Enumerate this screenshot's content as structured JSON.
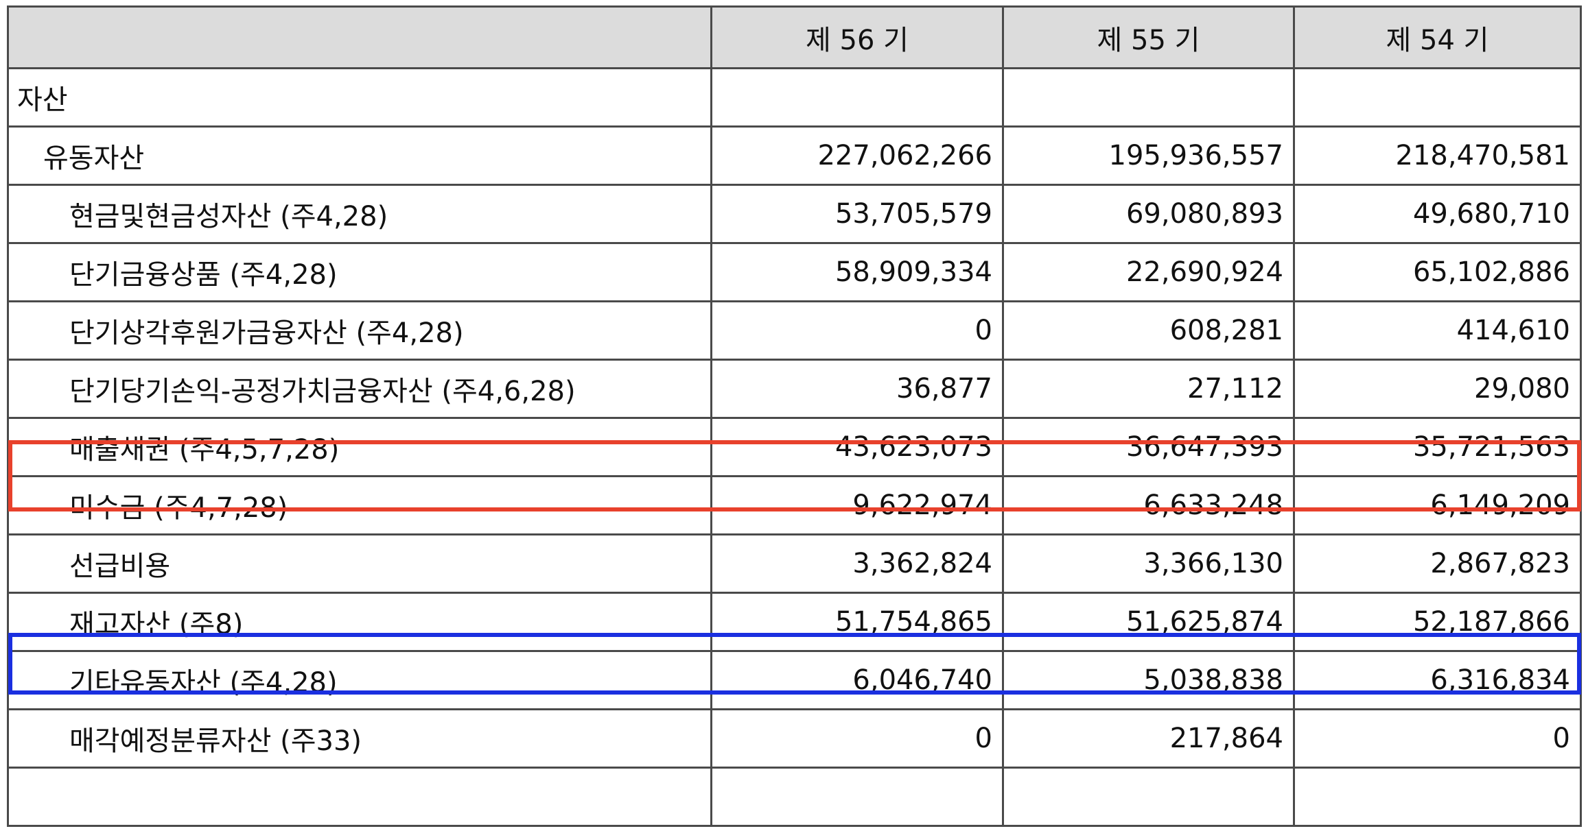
{
  "table": {
    "headers": [
      "",
      "제 56 기",
      "제 55 기",
      "제 54 기"
    ],
    "rows": [
      {
        "label": "자산",
        "level": 0,
        "values": [
          "",
          "",
          ""
        ]
      },
      {
        "label": "유동자산",
        "level": 1,
        "values": [
          "227,062,266",
          "195,936,557",
          "218,470,581"
        ]
      },
      {
        "label": "현금및현금성자산 (주4,28)",
        "level": 2,
        "values": [
          "53,705,579",
          "69,080,893",
          "49,680,710"
        ]
      },
      {
        "label": "단기금융상품 (주4,28)",
        "level": 2,
        "values": [
          "58,909,334",
          "22,690,924",
          "65,102,886"
        ]
      },
      {
        "label": "단기상각후원가금융자산 (주4,28)",
        "level": 2,
        "values": [
          "0",
          "608,281",
          "414,610"
        ]
      },
      {
        "label": "단기당기손익-공정가치금융자산 (주4,6,28)",
        "level": 2,
        "values": [
          "36,877",
          "27,112",
          "29,080"
        ]
      },
      {
        "label": "매출채권 (주4,5,7,28)",
        "level": 2,
        "values": [
          "43,623,073",
          "36,647,393",
          "35,721,563"
        ]
      },
      {
        "label": "미수금 (주4,7,28)",
        "level": 2,
        "values": [
          "9,622,974",
          "6,633,248",
          "6,149,209"
        ]
      },
      {
        "label": "선급비용",
        "level": 2,
        "values": [
          "3,362,824",
          "3,366,130",
          "2,867,823"
        ]
      },
      {
        "label": "재고자산 (주8)",
        "level": 2,
        "values": [
          "51,754,865",
          "51,625,874",
          "52,187,866"
        ]
      },
      {
        "label": "기타유동자산 (주4,28)",
        "level": 2,
        "values": [
          "6,046,740",
          "5,038,838",
          "6,316,834"
        ]
      },
      {
        "label": "매각예정분류자산 (주33)",
        "level": 2,
        "values": [
          "0",
          "217,864",
          "0"
        ]
      },
      {
        "label": "",
        "level": 2,
        "values": [
          "",
          "",
          ""
        ]
      }
    ]
  },
  "highlights": {
    "red_color": "#e8412c",
    "blue_color": "#1a2fe0"
  }
}
